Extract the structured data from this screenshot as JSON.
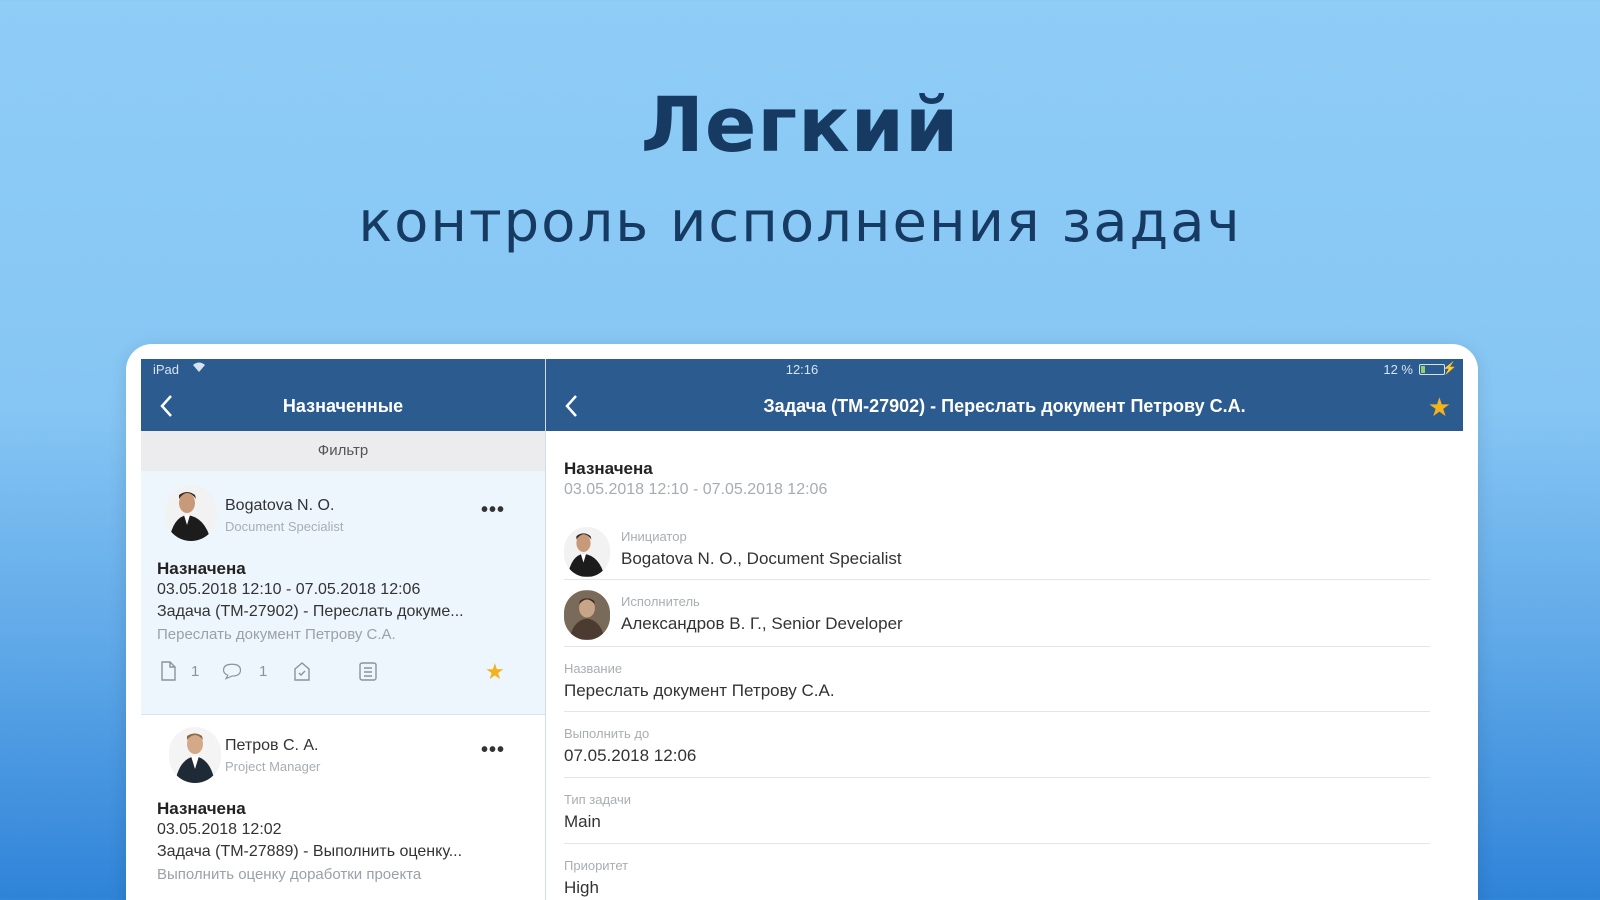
{
  "promo": {
    "headline": "Легкий",
    "subheadline": "контроль исполнения задач"
  },
  "statusbar": {
    "carrier": "iPad",
    "time": "12:16",
    "battery": "12 %"
  },
  "left_pane": {
    "title": "Назначенные",
    "filter_label": "Фильтр",
    "tasks": [
      {
        "name": "Bogatova N. O.",
        "role": "Document Specialist",
        "status": "Назначена",
        "dates": "03.05.2018 12:10 - 07.05.2018 12:06",
        "title": "Задача (TM-27902) - Переслать докуме...",
        "description": "Переслать документ Петрову С.А.",
        "attachments_count": "1",
        "comments_count": "1",
        "favorite": true
      },
      {
        "name": "Петров С. А.",
        "role": "Project Manager",
        "status": "Назначена",
        "dates": "03.05.2018 12:02",
        "title": "Задача (TM-27889) - Выполнить оценку...",
        "description": "Выполнить оценку доработки проекта"
      }
    ]
  },
  "right_pane": {
    "title": "Задача (TM-27902) - Переслать документ Петрову С.А.",
    "status": "Назначена",
    "dates": "03.05.2018 12:10 - 07.05.2018 12:06",
    "fields": [
      {
        "label": "Инициатор",
        "value": "Bogatova N. O., Document Specialist"
      },
      {
        "label": "Исполнитель",
        "value": "Александров В. Г., Senior Developer"
      },
      {
        "label": "Название",
        "value": "Переслать документ Петрову С.А."
      },
      {
        "label": "Выполнить до",
        "value": "07.05.2018 12:06"
      },
      {
        "label": "Тип задачи",
        "value": "Main"
      },
      {
        "label": "Приоритет",
        "value": "High"
      }
    ]
  },
  "colors": {
    "navbar": "#2c5b8f",
    "star": "#f4b21b",
    "background_top": "#8fcdf7",
    "background_bottom": "#2f83d8"
  },
  "icons": [
    "back-chevron-icon",
    "wifi-icon",
    "battery-icon",
    "star-icon",
    "more-icon",
    "document-icon",
    "comment-icon",
    "checklist-icon",
    "file-list-icon"
  ]
}
